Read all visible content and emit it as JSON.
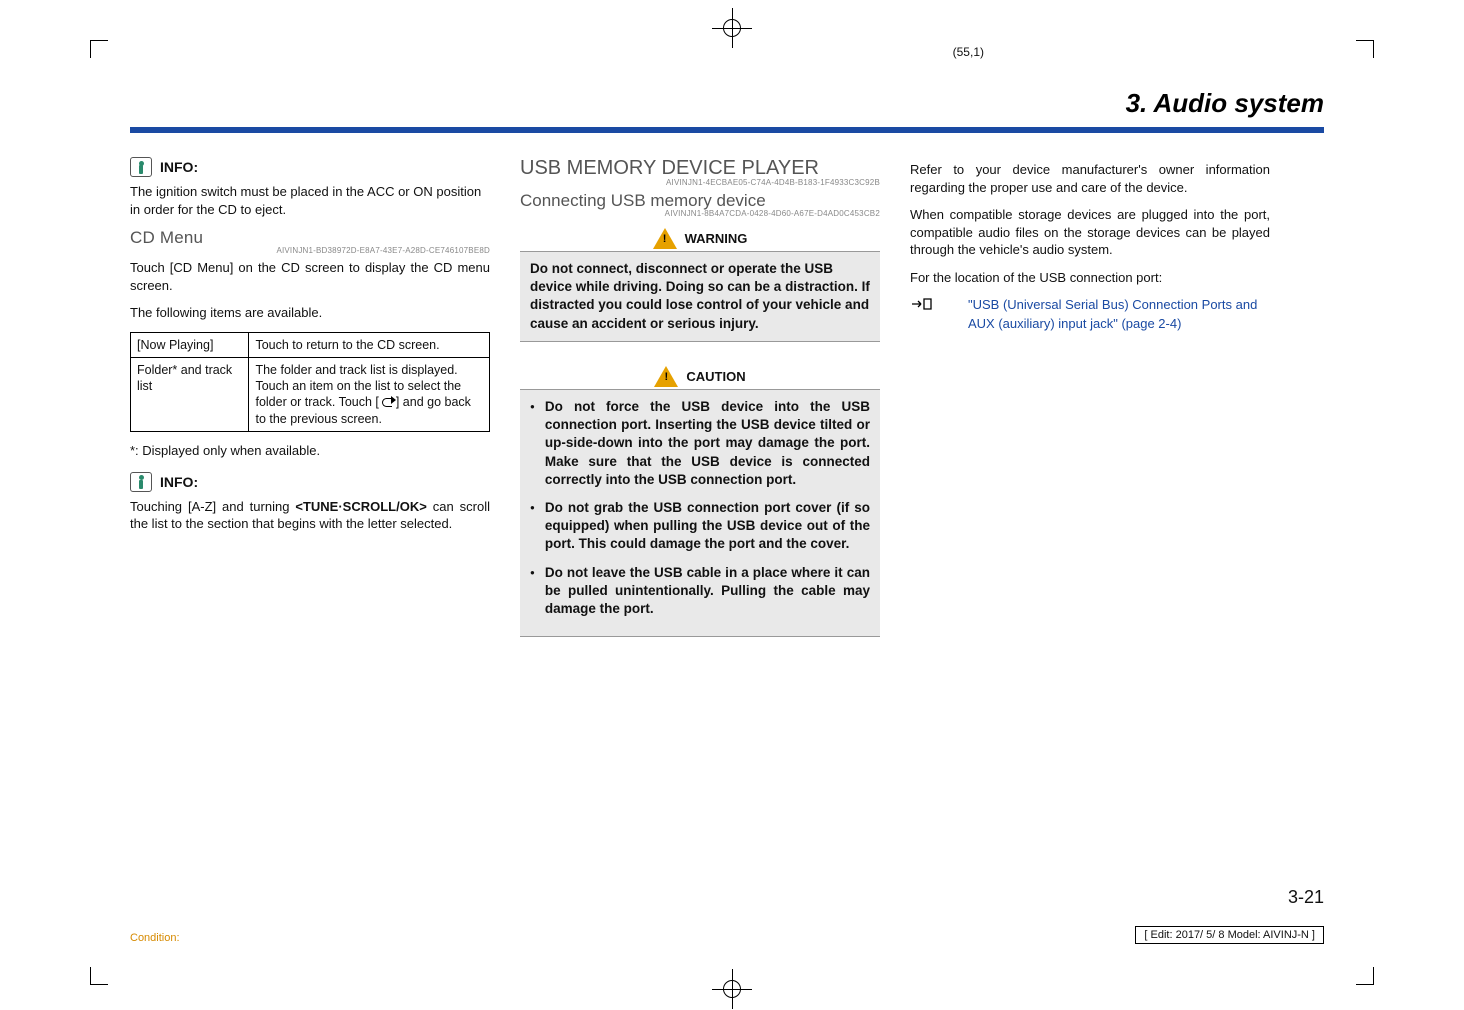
{
  "page_coord": "(55,1)",
  "chapter_heading": "3. Audio system",
  "col1": {
    "info_label": "INFO:",
    "info_para": "The ignition switch must be placed in the ACC or ON position in order for the CD to eject.",
    "cd_menu_heading": "CD Menu",
    "cd_menu_code": "AIVINJN1-BD38972D-E8A7-43E7-A28D-CE746107BE8D",
    "cd_para1": "Touch [CD Menu] on the CD screen to display the CD menu screen.",
    "cd_para2": "The following items are available.",
    "table": {
      "r1c1": "[Now Playing]",
      "r1c2": "Touch to return to the CD screen.",
      "r2c1": "Folder* and track list",
      "r2c2a": "The folder and track list is displayed.",
      "r2c2b": "Touch an item on the list to select the folder or track. Touch [ ",
      "r2c2c": " ] and go back to the previous screen."
    },
    "footnote": "*: Displayed only when available.",
    "info_label2": "INFO:",
    "info_para2a": "Touching [A-Z] and turning ",
    "info_para2b": "<TUNE·SCROLL/OK>",
    "info_para2c": " can scroll the list to the section that begins with the letter selected."
  },
  "col2": {
    "usb_heading": "USB MEMORY DEVICE PLAYER",
    "usb_code": "AIVINJN1-4ECBAE05-C74A-4D4B-B183-1F4933C3C92B",
    "usb_sub": "Connecting USB memory device",
    "usb_sub_code": "AIVINJN1-8B4A7CDA-0428-4D60-A67E-D4AD0C453CB2",
    "warning_label": "WARNING",
    "warning_text": "Do not connect, disconnect or operate the USB device while driving. Doing so can be a distraction. If distracted you could lose control of your vehicle and cause an accident or serious injury.",
    "caution_label": "CAUTION",
    "caution_items": [
      "Do not force the USB device into the USB connection port. Inserting the USB device tilted or up-side-down into the port may damage the port. Make sure that the USB device is connected correctly into the USB connection port.",
      "Do not grab the USB connection port cover (if so equipped) when pulling the USB device out of the port. This could damage the port and the cover.",
      "Do not leave the USB cable in a place where it can be pulled unintentionally. Pulling the cable may damage the port."
    ]
  },
  "col3": {
    "para1": "Refer to your device manufacturer's owner information regarding the proper use and care of the device.",
    "para2": "When compatible storage devices are plugged into the port, compatible audio files on the storage devices can be played through the vehicle's audio system.",
    "para3": "For the location of the USB connection port:",
    "ref_text": "\"USB (Universal Serial Bus) Connection Ports and AUX (auxiliary) input jack\" (page 2-4)"
  },
  "page_number": "3-21",
  "edit_line": "[ Edit: 2017/ 5/ 8    Model:  AIVINJ-N ]",
  "condition": "Condition:"
}
